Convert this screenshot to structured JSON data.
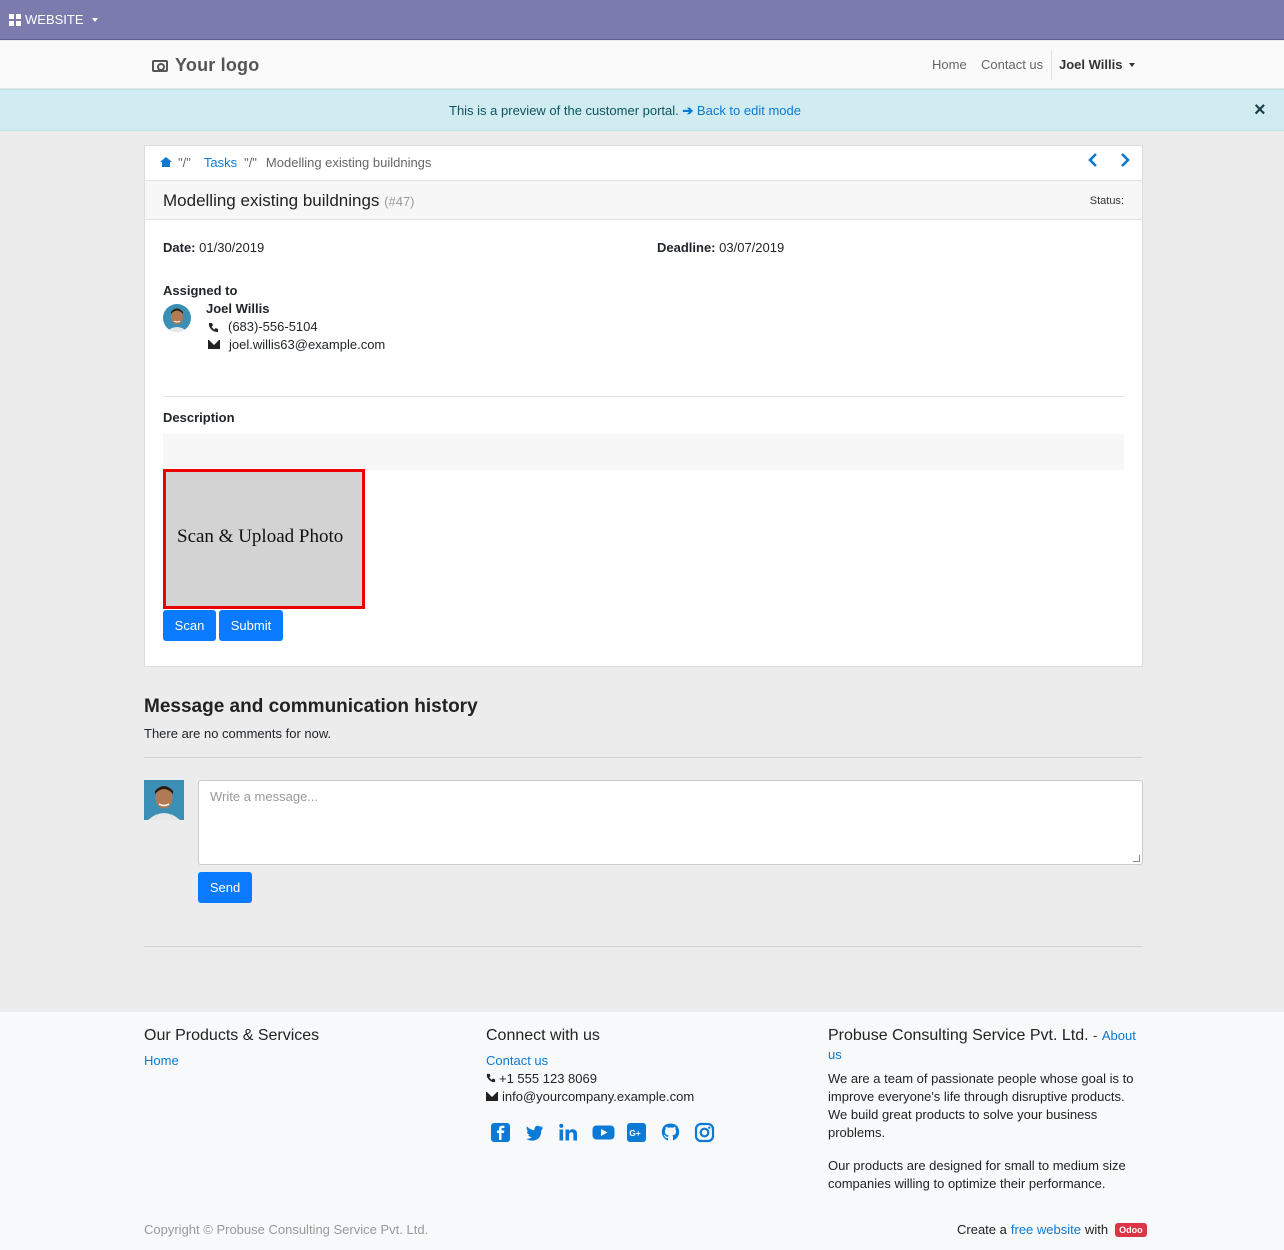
{
  "admin_bar": {
    "label": "WEBSITE"
  },
  "navbar": {
    "logo_text": "Your logo",
    "links": [
      "Home",
      "Contact us"
    ],
    "user": "Joel Willis"
  },
  "preview_alert": {
    "message": "This is a preview of the customer portal.",
    "link": "Back to edit mode",
    "close": "×"
  },
  "breadcrumb": {
    "sep": "\"/\"",
    "tasks": "Tasks",
    "current": "Modelling existing buildnings"
  },
  "task": {
    "title": "Modelling existing buildnings",
    "number": "(#47)",
    "status_label": "Status:",
    "date_label": "Date:",
    "date": "01/30/2019",
    "deadline_label": "Deadline:",
    "deadline": "03/07/2019",
    "assigned_label": "Assigned to",
    "assignee_name": "Joel Willis",
    "assignee_phone": "(683)-556-5104",
    "assignee_email": "joel.willis63@example.com",
    "description_label": "Description",
    "scan_box_text": "Scan & Upload Photo",
    "scan_button": "Scan",
    "submit_button": "Submit"
  },
  "messages": {
    "title": "Message and communication history",
    "empty": "There are no comments for now.",
    "placeholder": "Write a message...",
    "send_button": "Send"
  },
  "footer": {
    "col1": {
      "heading": "Our Products & Services",
      "link": "Home"
    },
    "col2": {
      "heading": "Connect with us",
      "link": "Contact us",
      "phone": "+1 555 123 8069",
      "email": "info@yourcompany.example.com",
      "social_icons": [
        "facebook-icon",
        "twitter-icon",
        "linkedin-icon",
        "youtube-icon",
        "google-plus-icon",
        "github-icon",
        "instagram-icon"
      ]
    },
    "col3": {
      "heading": "Probuse Consulting Service Pvt. Ltd.",
      "heading_sep": "-",
      "about_1": "About",
      "about_2": "us",
      "para1_l1": "We are a team of passionate people whose goal is to",
      "para1_l2": "improve everyone's life through disruptive products.",
      "para1_l3": "We build great products to solve your business",
      "para1_l4": "problems.",
      "para2_l1": "Our products are designed for small to medium size",
      "para2_l2": "companies willing to optimize their performance."
    },
    "copyright": "Copyright © Probuse Consulting Service Pvt. Ltd.",
    "create_prefix": "Create a",
    "create_link": "free website",
    "create_with": "with",
    "odoo": "Odoo"
  },
  "colors": {
    "admin_bar": "#7c7bad",
    "alert_bg": "#d1ecf1",
    "link": "#0a7ad6",
    "button": "#0a7bff",
    "scan_border": "#ee0000"
  }
}
